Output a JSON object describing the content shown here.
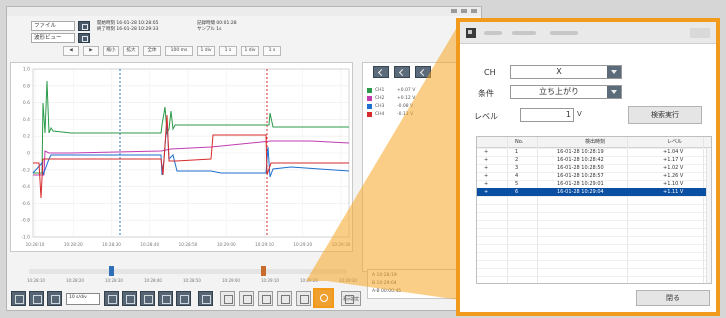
{
  "main": {
    "file_label": "ファイル",
    "view_label": "波形ビュー",
    "info_left": [
      "開始時刻  16-01-28 10:28:05",
      "終了時刻  16-01-28 10:29:33"
    ],
    "info_right": [
      "記録時間  00:01:28",
      "サンプル  1s"
    ],
    "toolbar2_items": [
      "◀",
      "▶",
      "縮小",
      "拡大",
      "全体",
      "100 ms",
      "1 div",
      "1 s",
      "1 div",
      "1 s"
    ],
    "y_ticks": [
      "1.0",
      "0.8",
      "0.6",
      "0.4",
      "0.2",
      "0",
      "-0.2",
      "-0.4",
      "-0.6",
      "-0.8",
      "-1.0"
    ],
    "x_ticks": [
      "10:28:10",
      "10:28:20",
      "10:28:30",
      "10:28:40",
      "10:28:50",
      "10:29:00",
      "10:29:10",
      "10:29:20",
      "10:29:30"
    ],
    "scroll_ticks": [
      "10:28:10",
      "10:28:20",
      "10:28:30",
      "10:28:40",
      "10:28:50",
      "10:29:00",
      "10:29:10",
      "10:29:20",
      "10:29:30"
    ],
    "channels": [
      {
        "label": "CH1",
        "value": "+0.07 V",
        "color": "#2a9a4a"
      },
      {
        "label": "CH2",
        "value": "+0.12 V",
        "color": "#c03cb0"
      },
      {
        "label": "CH3",
        "value": "-0.08 V",
        "color": "#1e6fd0"
      },
      {
        "label": "CH4",
        "value": "-0.13 V",
        "color": "#d62b2b"
      }
    ],
    "cursor_rows": [
      "A    10:28:19",
      "B    10:29:04",
      "A-B  00:00:45"
    ],
    "bottom_select": "10 s/div",
    "bottom_label": "表示設定"
  },
  "dialog": {
    "ch_label": "CH",
    "ch_value": "X",
    "condition_label": "条件",
    "condition_value": "立ち上がり",
    "level_label": "レベル",
    "level_value": "1",
    "level_unit": "V",
    "search_button": "検索実行",
    "close_button": "閉る",
    "columns": [
      "No.",
      "検出時刻",
      "レベル"
    ],
    "rows": [
      {
        "mark": "+",
        "no": "1",
        "time": "16-01-28 10:28:19",
        "level": "+1.04 V"
      },
      {
        "mark": "+",
        "no": "2",
        "time": "16-01-28 10:28:42",
        "level": "+1.17 V"
      },
      {
        "mark": "+",
        "no": "3",
        "time": "16-01-28 10:28:50",
        "level": "+1.02 V"
      },
      {
        "mark": "+",
        "no": "4",
        "time": "16-01-28 10:28:57",
        "level": "+1.26 V"
      },
      {
        "mark": "+",
        "no": "5",
        "time": "16-01-28 10:29:01",
        "level": "+1.10 V"
      },
      {
        "mark": "+",
        "no": "6",
        "time": "16-01-28 10:29:04",
        "level": "+1.11 V"
      }
    ],
    "selected_row": 5
  },
  "colors": {
    "accent": "#f19a1c",
    "selection": "#0b4fa3",
    "cursor_a": "#2f6fb8",
    "cursor_b": "#d62b2b"
  }
}
